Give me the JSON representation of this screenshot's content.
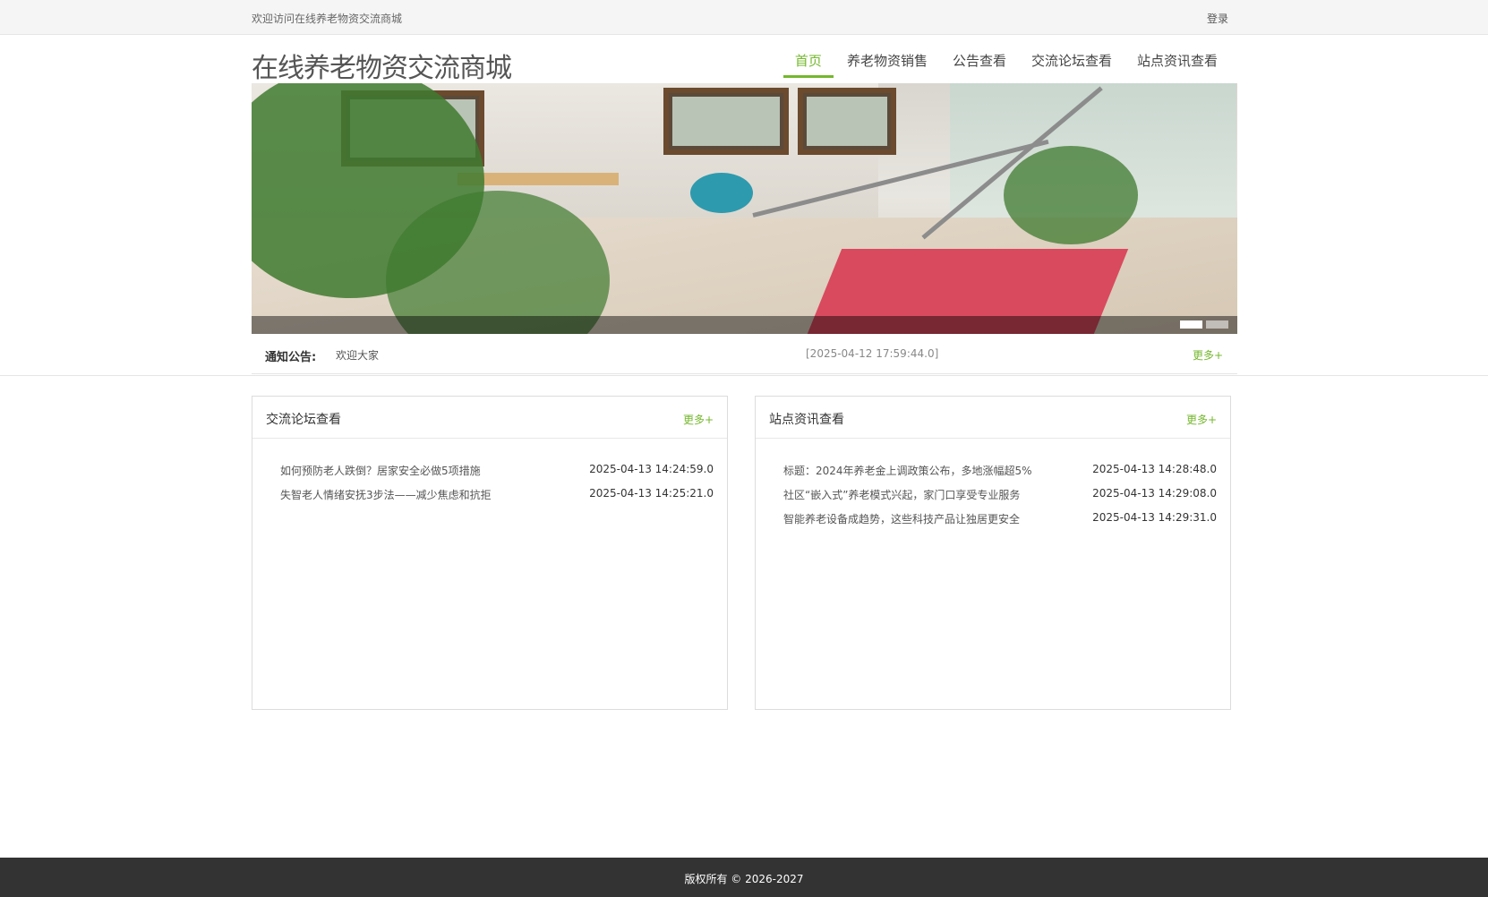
{
  "topbar": {
    "welcome": "欢迎访问在线养老物资交流商城",
    "login": "登录"
  },
  "header": {
    "logo": "在线养老物资交流商城",
    "nav": [
      {
        "label": "首页",
        "active": true
      },
      {
        "label": "养老物资销售",
        "active": false
      },
      {
        "label": "公告查看",
        "active": false
      },
      {
        "label": "交流论坛查看",
        "active": false
      },
      {
        "label": "站点资讯查看",
        "active": false
      }
    ]
  },
  "banner": {
    "slide_count": 2,
    "active_slide": 1
  },
  "notice": {
    "label": "通知公告:",
    "text": "欢迎大家",
    "date": "[2025-04-12 17:59:44.0]",
    "more": "更多+"
  },
  "forum_panel": {
    "title": "交流论坛查看",
    "more": "更多+",
    "items": [
      {
        "title": "如何预防老人跌倒？居家安全必做5项措施",
        "date": "2025-04-13 14:24:59.0"
      },
      {
        "title": "失智老人情绪安抚3步法——减少焦虑和抗拒",
        "date": "2025-04-13 14:25:21.0"
      }
    ]
  },
  "news_panel": {
    "title": "站点资讯查看",
    "more": "更多+",
    "items": [
      {
        "title": "标题：2024年养老金上调政策公布，多地涨幅超5%",
        "date": "2025-04-13 14:28:48.0"
      },
      {
        "title": "社区“嵌入式”养老模式兴起，家门口享受专业服务",
        "date": "2025-04-13 14:29:08.0"
      },
      {
        "title": "智能养老设备成趋势，这些科技产品让独居更安全",
        "date": "2025-04-13 14:29:31.0"
      }
    ]
  },
  "footer": {
    "copyright": "版权所有 © 2026-2027"
  },
  "colors": {
    "accent": "#74b72d",
    "footer_bg": "#333333"
  }
}
